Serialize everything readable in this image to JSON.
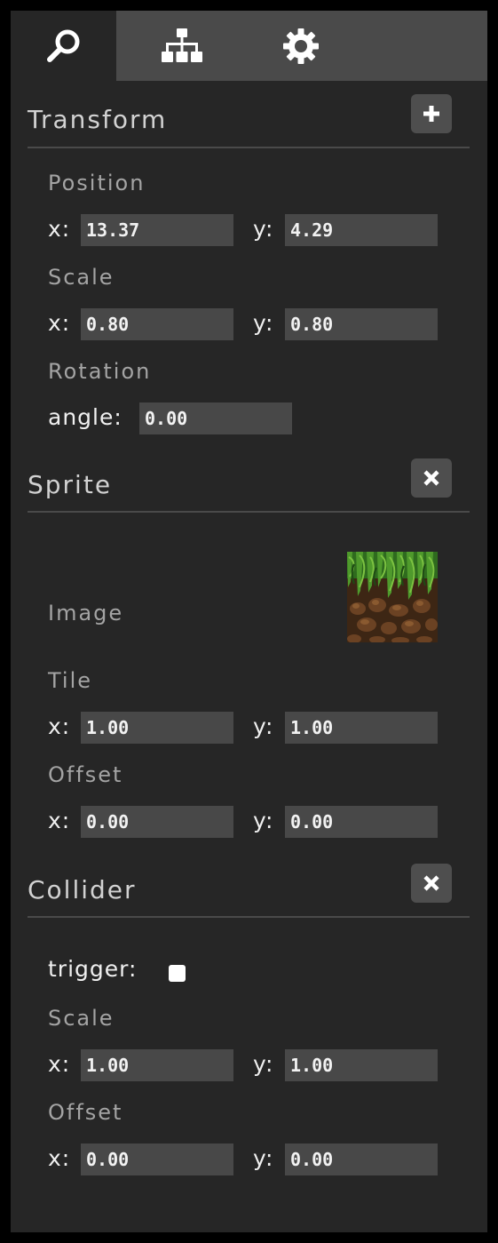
{
  "tabs": [
    {
      "icon": "search-icon",
      "active": true
    },
    {
      "icon": "hierarchy-icon",
      "active": false
    },
    {
      "icon": "gear-icon",
      "active": false
    }
  ],
  "transform": {
    "title": "Transform",
    "button_icon": "plus-icon",
    "position_label": "Position",
    "position": {
      "x_label": "x:",
      "x": "13.37",
      "y_label": "y:",
      "y": "4.29"
    },
    "scale_label": "Scale",
    "scale": {
      "x_label": "x:",
      "x": "0.80",
      "y_label": "y:",
      "y": "0.80"
    },
    "rotation_label": "Rotation",
    "rotation": {
      "angle_label": "angle:",
      "angle": "0.00"
    }
  },
  "sprite": {
    "title": "Sprite",
    "button_icon": "close-icon",
    "image_label": "Image",
    "image_icon": "grass-dirt-tile-thumbnail",
    "tile_label": "Tile",
    "tile": {
      "x_label": "x:",
      "x": "1.00",
      "y_label": "y:",
      "y": "1.00"
    },
    "offset_label": "Offset",
    "offset": {
      "x_label": "x:",
      "x": "0.00",
      "y_label": "y:",
      "y": "0.00"
    }
  },
  "collider": {
    "title": "Collider",
    "button_icon": "close-icon",
    "trigger_label": "trigger:",
    "trigger_checked": false,
    "scale_label": "Scale",
    "scale": {
      "x_label": "x:",
      "x": "1.00",
      "y_label": "y:",
      "y": "1.00"
    },
    "offset_label": "Offset",
    "offset": {
      "x_label": "x:",
      "x": "0.00",
      "y_label": "y:",
      "y": "0.00"
    }
  },
  "colors": {
    "background": "#262626",
    "tabbar": "#4a4a4a",
    "field": "#484848",
    "button": "#4e4e4e",
    "label": "#a4a4a4",
    "text": "#f0f0f0"
  }
}
